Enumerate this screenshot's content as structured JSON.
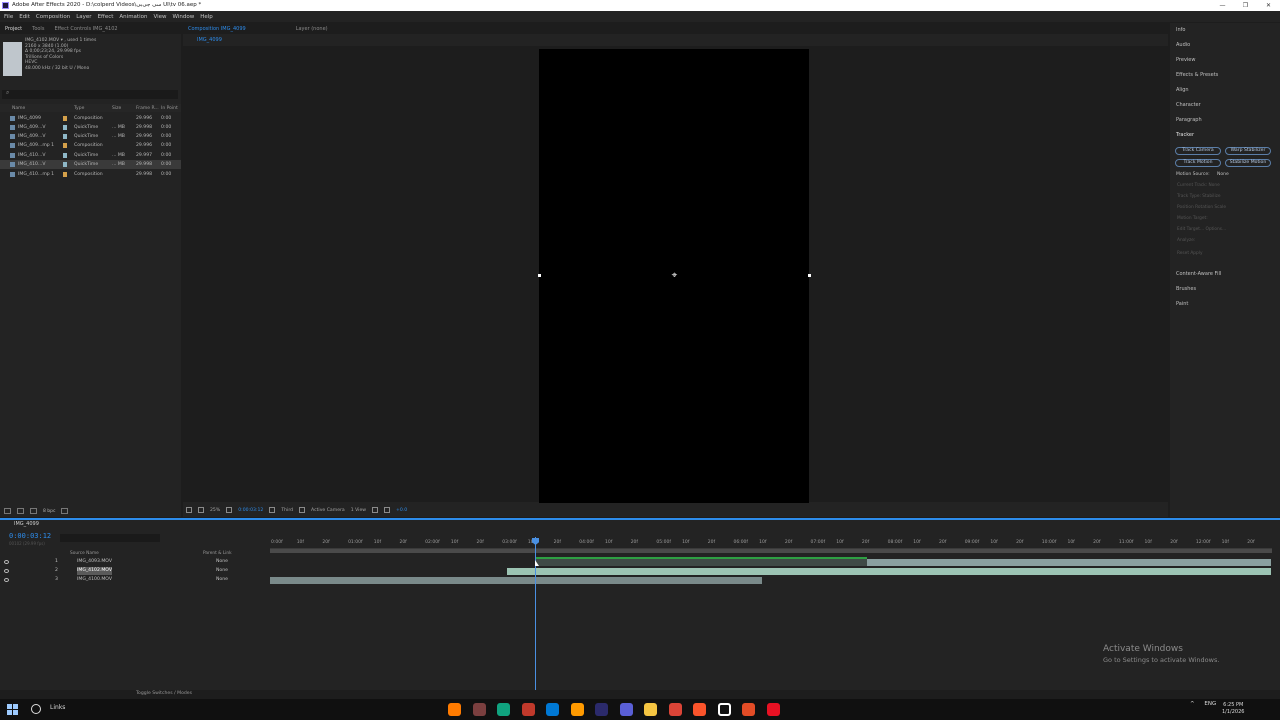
{
  "window": {
    "title": "Adobe After Effects 2020 - D:\\colperd Videos\\سی‌ جی‌بی UI\\tv 06.aep *",
    "controls": [
      "—",
      "❐",
      "✕"
    ]
  },
  "menu": [
    "File",
    "Edit",
    "Composition",
    "Layer",
    "Effect",
    "Animation",
    "View",
    "Window",
    "Help"
  ],
  "project_panel": {
    "tabs": [
      "Project",
      "Tools",
      "Effect Controls IMG_4102"
    ],
    "info_lines": [
      "IMG_4102.MOV  ▾ , used 1 times",
      "2160 x 3840 (1.00)",
      "Δ 0;00;23;24, 29.998 fps",
      "Trillions of Colors",
      "HEVC",
      "48.000 kHz / 32 bit U / Mono"
    ],
    "search_icon": "⌕",
    "columns": [
      "Name",
      "Type",
      "Size",
      "Frame R...",
      "In Point"
    ],
    "rows": [
      {
        "name": "IMG_4099",
        "type": "Composition",
        "size": "",
        "fps": "29.996",
        "in": "0:00"
      },
      {
        "name": "IMG_409...V",
        "type": "QuickTime",
        "size": "... MB",
        "fps": "29.998",
        "in": "0:00"
      },
      {
        "name": "IMG_409...V",
        "type": "QuickTime",
        "size": "... MB",
        "fps": "29.996",
        "in": "0:00"
      },
      {
        "name": "IMG_409...mp 1",
        "type": "Composition",
        "size": "",
        "fps": "29.996",
        "in": "0:00"
      },
      {
        "name": "IMG_410...V",
        "type": "QuickTime",
        "size": "... MB",
        "fps": "29.997",
        "in": "0:00"
      },
      {
        "name": "IMG_410...V",
        "type": "QuickTime",
        "size": "... MB",
        "fps": "29.998",
        "in": "0:00"
      },
      {
        "name": "IMG_410...mp 1",
        "type": "Composition",
        "size": "",
        "fps": "29.998",
        "in": "0:00"
      }
    ],
    "footer_bpc": "8 bpc"
  },
  "viewer": {
    "tabs": [
      "Composition IMG_4099",
      "Layer (none)"
    ],
    "breadcrumb": "IMG_4099",
    "toolbar": {
      "zoom": "25%",
      "timecode": "0:00:03:12",
      "resolution": "Third",
      "camera": "Active Camera",
      "views": "1 View",
      "exposure": "+0.0"
    }
  },
  "right_panel": {
    "items_top": [
      "Info",
      "Audio",
      "Preview",
      "Effects & Presets",
      "Align",
      "Character",
      "Paragraph"
    ],
    "tracker": {
      "title": "Tracker",
      "buttons": [
        "Track Camera",
        "Warp Stabilizer",
        "Track Motion",
        "Stabilize Motion"
      ],
      "motion_source_label": "Motion Source:",
      "motion_source_value": "None",
      "disabled_lines": [
        "Current Track:  None",
        "Track Type:  Stabilize",
        "Position   Rotation   Scale",
        "Motion Target:",
        "Edit Target...     Options...",
        "Analyze:",
        "Reset          Apply"
      ]
    },
    "items_bottom": [
      "Content-Aware Fill",
      "Brushes",
      "Paint"
    ]
  },
  "timeline": {
    "tab": "IMG_4099",
    "timecode": "0:00:03:12",
    "frames_label": "00102 (29.99 fps)",
    "search_placeholder": "",
    "header": [
      "Source Name",
      "Parent & Link"
    ],
    "layers": [
      {
        "num": "1",
        "name": "IMG_4093.MOV",
        "parent": "None"
      },
      {
        "num": "2",
        "name": "IMG_4102.MOV",
        "parent": "None"
      },
      {
        "num": "3",
        "name": "IMG_4100.MOV",
        "parent": "None"
      }
    ],
    "ruler": [
      "0:00f",
      "10f",
      "20f",
      "01:00f",
      "10f",
      "20f",
      "02:00f",
      "10f",
      "20f",
      "03:00f",
      "10f",
      "20f",
      "04:00f",
      "10f",
      "20f",
      "05:00f",
      "10f",
      "20f",
      "06:00f",
      "10f",
      "20f",
      "07:00f",
      "10f",
      "20f",
      "08:00f",
      "10f",
      "20f",
      "09:00f",
      "10f",
      "20f",
      "10:00f",
      "10f",
      "20f",
      "11:00f",
      "10f",
      "20f",
      "12:00f",
      "10f",
      "20f"
    ],
    "footer": "Toggle Switches / Modes"
  },
  "activate": {
    "title": "Activate Windows",
    "subtitle": "Go to Settings to activate Windows."
  },
  "taskbar": {
    "links": "Links",
    "tray_lang": "ENG",
    "time": "6:25 PM",
    "date": "1/1/2026",
    "app_colors": [
      "#ff7b00",
      "#7b3f3f",
      "#10a37f",
      "#c0392b",
      "#0078d4",
      "#ff9a00",
      "#2b2a6b",
      "#5a5fd6",
      "#f5c542",
      "#db4437",
      "#fb542b",
      "#ffffff",
      "#e34c26",
      "#e81123"
    ]
  },
  "colors": {
    "accent": "#2d8ceb",
    "layer1": "#8aa0a0",
    "layer2": "#9cc4b3",
    "layer3": "#7a8a8a",
    "workarea_green": "#2ea043"
  }
}
